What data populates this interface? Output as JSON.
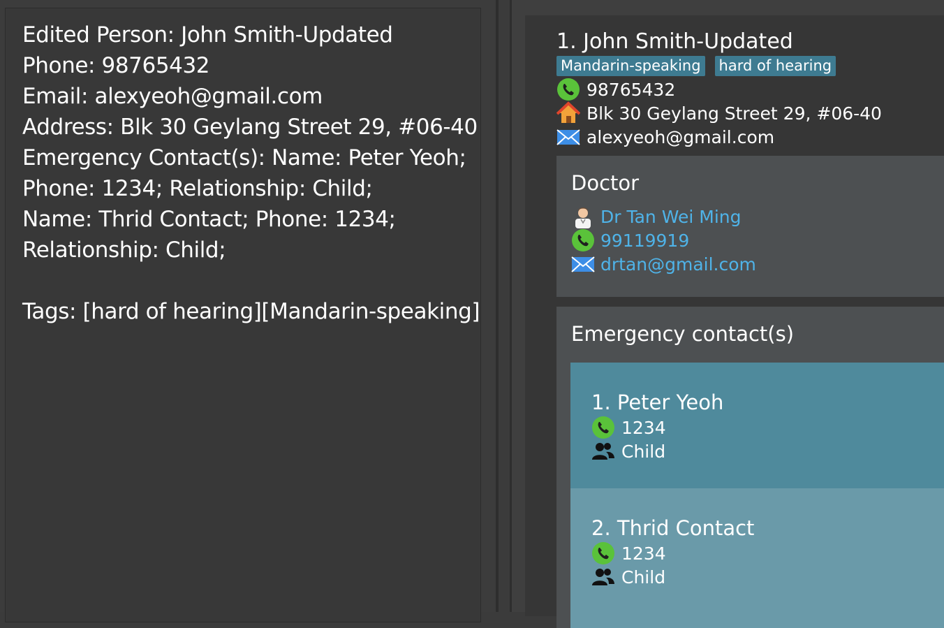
{
  "result_display": {
    "text": "Edited Person: John Smith-Updated\nPhone: 98765432\nEmail: alexyeoh@gmail.com\nAddress: Blk 30 Geylang Street 29, #06-40\nEmergency Contact(s): Name: Peter Yeoh;\nPhone: 1234; Relationship: Child;\nName: Thrid Contact; Phone: 1234;\nRelationship: Child;\n\nTags: [hard of hearing][Mandarin-speaking]"
  },
  "person": {
    "name": "1. John Smith-Updated",
    "tags": [
      "Mandarin-speaking",
      "hard of hearing"
    ],
    "phone": "98765432",
    "address": "Blk 30 Geylang Street 29, #06-40",
    "email": "alexyeoh@gmail.com",
    "doctor": {
      "title": "Doctor",
      "name": "Dr Tan Wei Ming",
      "phone": "99119919",
      "email": "drtan@gmail.com"
    },
    "emergency": {
      "title": "Emergency contact(s)",
      "contacts": [
        {
          "name": "1. Peter Yeoh",
          "phone": "1234",
          "relationship": "Child"
        },
        {
          "name": "2. Thrid Contact",
          "phone": "1234",
          "relationship": "Child"
        }
      ]
    }
  },
  "colors": {
    "tag": "#3e7b91",
    "link": "#4fb3e8",
    "contact_1": "#4f8a9c",
    "contact_2": "#6a9aa9",
    "phone_icon": "#5ac23a"
  },
  "icons": {
    "phone": "phone-icon",
    "address": "home-icon",
    "email": "mail-icon",
    "doctor": "doctor-avatar-icon",
    "relationship": "people-icon"
  }
}
